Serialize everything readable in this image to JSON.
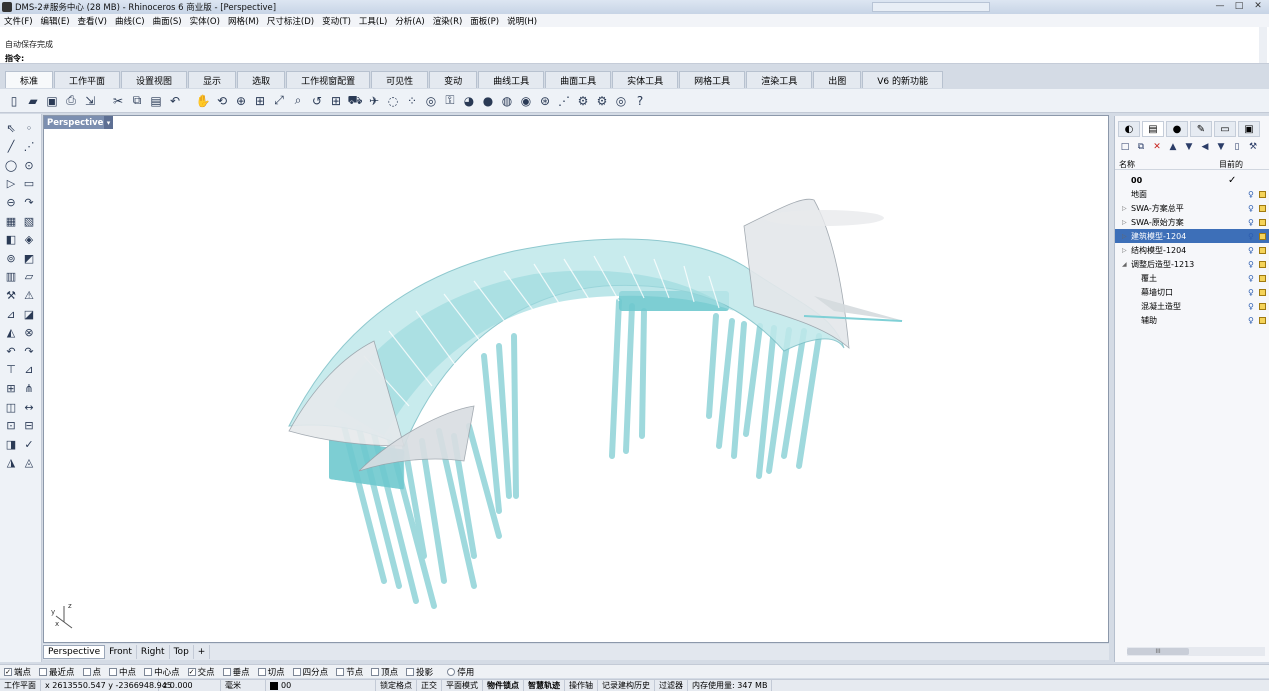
{
  "window": {
    "title": "DMS-2#服务中心 (28 MB) - Rhinoceros 6 商业版 - [Perspective]",
    "controls": [
      "—",
      "□",
      "✕"
    ]
  },
  "menu": [
    "文件(F)",
    "编辑(E)",
    "查看(V)",
    "曲线(C)",
    "曲面(S)",
    "实体(O)",
    "网格(M)",
    "尺寸标注(D)",
    "变动(T)",
    "工具(L)",
    "分析(A)",
    "渲染(R)",
    "面板(P)",
    "说明(H)"
  ],
  "history": {
    "line1": "自动保存完成",
    "command_label": "指令:",
    "command_value": ""
  },
  "toolbar_tabs": [
    {
      "label": "标准",
      "active": true
    },
    {
      "label": "工作平面",
      "active": false
    },
    {
      "label": "设置视图",
      "active": false
    },
    {
      "label": "显示",
      "active": false
    },
    {
      "label": "选取",
      "active": false
    },
    {
      "label": "工作视窗配置",
      "active": false
    },
    {
      "label": "可见性",
      "active": false
    },
    {
      "label": "变动",
      "active": false
    },
    {
      "label": "曲线工具",
      "active": false
    },
    {
      "label": "曲面工具",
      "active": false
    },
    {
      "label": "实体工具",
      "active": false
    },
    {
      "label": "网格工具",
      "active": false
    },
    {
      "label": "渲染工具",
      "active": false
    },
    {
      "label": "出图",
      "active": false
    },
    {
      "label": "V6 的新功能",
      "active": false
    }
  ],
  "toolbar_icons": [
    "new-file-icon",
    "open-file-icon",
    "save-icon",
    "print-icon",
    "import-icon",
    "cut-icon",
    "copy-icon",
    "paste-icon",
    "undo-icon",
    "pan-hand-icon",
    "rotate-view-icon",
    "zoom-dynamic-icon",
    "zoom-window-icon",
    "zoom-extents-icon",
    "zoom-selected-icon",
    "undo-view-icon",
    "four-viewports-icon",
    "car-icon",
    "plane-icon",
    "hide-icon",
    "points-on-icon",
    "light-icon",
    "lock-icon",
    "color-icon",
    "sphere-icon",
    "material-icon",
    "render-icon",
    "globe-icon",
    "grid-snap-icon",
    "settings-icon",
    "options-icon",
    "world-icon",
    "help-icon"
  ],
  "viewport": {
    "label": "Perspective"
  },
  "viewport_tabs": [
    {
      "label": "Perspective",
      "active": true
    },
    {
      "label": "Front",
      "active": false
    },
    {
      "label": "Right",
      "active": false
    },
    {
      "label": "Top",
      "active": false
    },
    {
      "label": "+",
      "active": false
    }
  ],
  "axis": {
    "z": "z",
    "y": "y",
    "x": "x"
  },
  "layers_panel": {
    "col_name": "名称",
    "col_current": "目前的",
    "current_layer": "00",
    "current_mark": "✓",
    "layers": [
      {
        "name": "地面",
        "indent": 0,
        "arrow": "",
        "selected": false
      },
      {
        "name": "SWA-方案总平",
        "indent": 0,
        "arrow": "▷",
        "selected": false
      },
      {
        "name": "SWA-原始方案",
        "indent": 0,
        "arrow": "▷",
        "selected": false
      },
      {
        "name": "建筑模型-1204",
        "indent": 0,
        "arrow": "▷",
        "selected": true
      },
      {
        "name": "结构模型-1204",
        "indent": 0,
        "arrow": "▷",
        "selected": false
      },
      {
        "name": "调整后造型-1213",
        "indent": 0,
        "arrow": "◢",
        "selected": false
      },
      {
        "name": "覆土",
        "indent": 1,
        "arrow": "",
        "selected": false
      },
      {
        "name": "幕墙切口",
        "indent": 1,
        "arrow": "",
        "selected": false
      },
      {
        "name": "混凝土造型",
        "indent": 1,
        "arrow": "",
        "selected": false
      },
      {
        "name": "辅助",
        "indent": 1,
        "arrow": "",
        "selected": false
      }
    ],
    "hscroll_thumb": "III"
  },
  "osnaps": [
    {
      "label": "端点",
      "checked": true,
      "type": "check"
    },
    {
      "label": "最近点",
      "checked": false,
      "type": "check"
    },
    {
      "label": "点",
      "checked": false,
      "type": "check"
    },
    {
      "label": "中点",
      "checked": false,
      "type": "check"
    },
    {
      "label": "中心点",
      "checked": false,
      "type": "check"
    },
    {
      "label": "交点",
      "checked": true,
      "type": "check"
    },
    {
      "label": "垂点",
      "checked": false,
      "type": "check"
    },
    {
      "label": "切点",
      "checked": false,
      "type": "check"
    },
    {
      "label": "四分点",
      "checked": false,
      "type": "check"
    },
    {
      "label": "节点",
      "checked": false,
      "type": "check"
    },
    {
      "label": "顶点",
      "checked": false,
      "type": "check"
    },
    {
      "label": "投影",
      "checked": false,
      "type": "check"
    },
    {
      "label": "停用",
      "checked": false,
      "type": "radio"
    }
  ],
  "status": {
    "cplane": "工作平面",
    "coords": "x 2613550.547 y -2366948.945",
    "z": "z 0.000",
    "units": "毫米",
    "layer": "00",
    "toggles": [
      "锁定格点",
      "正交",
      "平面模式",
      "物件锁点",
      "智慧轨迹",
      "操作轴",
      "记录建构历史",
      "过滤器"
    ],
    "bold_toggles": [
      "物件锁点",
      "智慧轨迹"
    ],
    "memory": "内存使用量: 347 MB"
  }
}
